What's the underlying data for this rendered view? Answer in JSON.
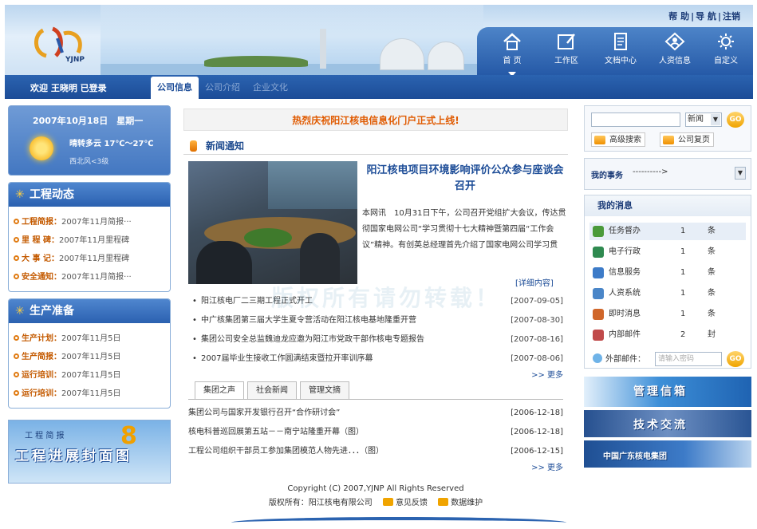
{
  "header": {
    "logo_text": "YJNP",
    "top_links": [
      "帮 助",
      "导 航",
      "注销"
    ],
    "nav": [
      {
        "label": "首 页",
        "icon": "home-icon",
        "active": true
      },
      {
        "label": "工作区",
        "icon": "workspace-icon",
        "active": false
      },
      {
        "label": "文档中心",
        "icon": "document-icon",
        "active": false
      },
      {
        "label": "人资信息",
        "icon": "hr-info-icon",
        "active": false
      },
      {
        "label": "自定义",
        "icon": "customize-icon",
        "active": false
      }
    ]
  },
  "bar": {
    "welcome": "欢迎 王晓明 已登录",
    "tabs": [
      "公司信息",
      "公司介绍",
      "企业文化"
    ]
  },
  "left": {
    "date": "2007年10月18日　星期一",
    "weather": "晴转多云 17℃～27℃",
    "wind": "西北风<3级",
    "panels": [
      {
        "title": "工程动态",
        "items": [
          {
            "key": "工程简报：",
            "text": "2007年11月简报···"
          },
          {
            "key": "里 程 碑：",
            "text": "2007年11月里程碑"
          },
          {
            "key": "大 事 记：",
            "text": "2007年11月里程碑"
          },
          {
            "key": "安全通知：",
            "text": "2007年11月简报···"
          }
        ]
      },
      {
        "title": "生产准备",
        "items": [
          {
            "key": "生产计划：",
            "text": "2007年11月5日"
          },
          {
            "key": "生产简报：",
            "text": "2007年11月5日"
          },
          {
            "key": "运行培训：",
            "text": "2007年11月5日"
          },
          {
            "key": "运行培训：",
            "text": "2007年11月5日"
          }
        ]
      }
    ],
    "banner": {
      "line1": "工 程 简 报",
      "num": "8",
      "line2": "工程进展封面图"
    }
  },
  "mid": {
    "announce": "热烈庆祝阳江核电信息化门户正式上线!",
    "section_title": "新闻通知",
    "headline": "阳江核电项目环境影响评价公众参与座谈会召开",
    "summary": "本网讯　10月31日下午，公司召开党组扩大会议，传达贯彻国家电网公司“学习贯彻十七大精神暨第四届“工作会议”精神。有创英总经理首先介绍了国家电网公司学习贯",
    "detail": "[详细内容]",
    "news": [
      {
        "title": "阳江核电厂二三期工程正式开工",
        "date": "[2007-09-05]"
      },
      {
        "title": "中广核集团第三届大学生夏令营活动在阳江核电基地隆重开营",
        "date": "[2007-08-30]"
      },
      {
        "title": "集团公司安全总监魏迪龙应邀为阳江市党政干部作核电专题报告",
        "date": "[2007-08-16]"
      },
      {
        "title": "2007届毕业生接收工作圆满结束暨拉开率训序幕",
        "date": "[2007-08-06]"
      }
    ],
    "more": ">> 更多",
    "tabs": [
      "集团之声",
      "社会新闻",
      "管理文摘"
    ],
    "list2": [
      {
        "title": "集团公司与国家开发银行召开“合作研讨会”",
        "date": "[2006-12-18]"
      },
      {
        "title": "核电科普巡回展第五站－－南宁站隆重开幕（图）",
        "date": "[2006-12-18]"
      },
      {
        "title": "工程公司组织干部员工参加集团模范人物先进．．．（图）",
        "date": "[2006-12-15]"
      }
    ],
    "more2": ">> 更多"
  },
  "right": {
    "search_select": "新闻",
    "go": "GO",
    "btn_advanced": "高级搜索",
    "btn_company": "公司复页",
    "affairs_label": "我的事务",
    "affairs_select": "---------->",
    "messages_title": "我的消息",
    "messages": [
      {
        "name": "任务督办",
        "count": "1",
        "unit": "条",
        "color": "#4a9a3a"
      },
      {
        "name": "电子行政",
        "count": "1",
        "unit": "条",
        "color": "#2f8a50"
      },
      {
        "name": "信息服务",
        "count": "1",
        "unit": "条",
        "color": "#3d7bc8"
      },
      {
        "name": "人资系统",
        "count": "1",
        "unit": "条",
        "color": "#4a86c8"
      },
      {
        "name": "即时消息",
        "count": "1",
        "unit": "条",
        "color": "#d0662a"
      },
      {
        "name": "内部邮件",
        "count": "2",
        "unit": "封",
        "color": "#c04a4a"
      }
    ],
    "mail_label": "外部邮件：",
    "mail_placeholder": "请输入密码",
    "banners": [
      "管理信箱",
      "技术交流",
      "中国广东核电集团"
    ]
  },
  "footer": {
    "copyright": "Copyright (C) 2007,YJNP  All Rights Reserved",
    "owner": "版权所有：阳江核电有限公司",
    "feedback": "意见反馈",
    "maintenance": "数据维护"
  },
  "watermark": "版权所有请勿转载！"
}
